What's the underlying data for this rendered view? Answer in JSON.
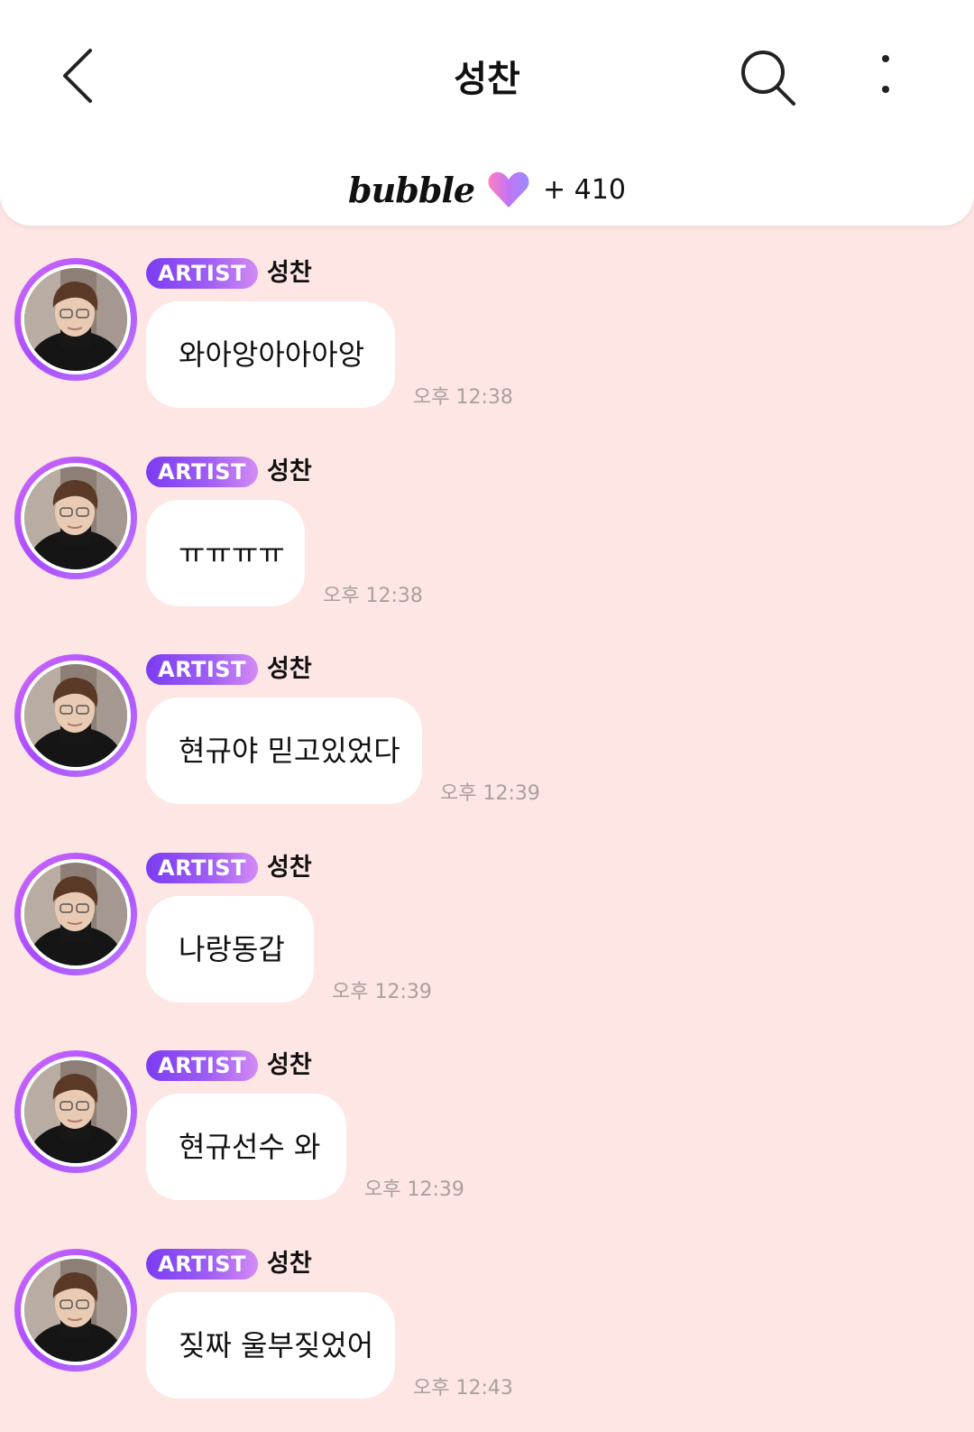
{
  "header": {
    "title": "성찬",
    "brand_name": "bubble",
    "heart_count": "+ 410"
  },
  "colors": {
    "background": "#fde6e3",
    "badge_start": "#7b3cf2",
    "badge_end": "#d38bf3",
    "avatar_ring": "#b45cff"
  },
  "messages": [
    {
      "badge": "ARTIST",
      "sender": "성찬",
      "text": "와아앙아아아앙",
      "time": "오후 12:38"
    },
    {
      "badge": "ARTIST",
      "sender": "성찬",
      "text": "ㅠㅠㅠㅠ",
      "time": "오후 12:38"
    },
    {
      "badge": "ARTIST",
      "sender": "성찬",
      "text": "현규야 믿고있었다",
      "time": "오후 12:39"
    },
    {
      "badge": "ARTIST",
      "sender": "성찬",
      "text": "나랑동갑",
      "time": "오후 12:39"
    },
    {
      "badge": "ARTIST",
      "sender": "성찬",
      "text": "현규선수 와",
      "time": "오후 12:39"
    },
    {
      "badge": "ARTIST",
      "sender": "성찬",
      "text": "짖짜 울부짖었어",
      "time": "오후 12:43"
    }
  ]
}
